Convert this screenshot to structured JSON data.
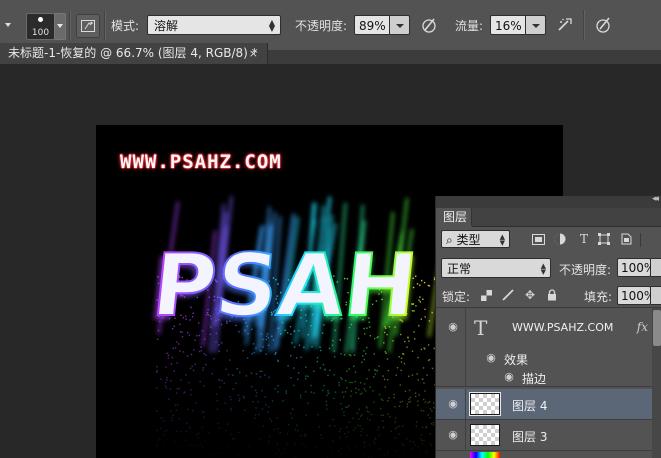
{
  "options_bar": {
    "brush_size": "100",
    "mode_label": "模式:",
    "mode_value": "溶解",
    "opacity_label": "不透明度:",
    "opacity_value": "89%",
    "flow_label": "流量:",
    "flow_value": "16%"
  },
  "document_tab": {
    "title": "未标题-1-恢复的 @ 66.7% (图层 4, RGB/8) *",
    "close": "×"
  },
  "canvas": {
    "watermark": "WWW.PSAHZ.COM",
    "art_text": "PSAH"
  },
  "layers_panel": {
    "tab_label": "图层",
    "filter_value": "类型",
    "blend_mode": "正常",
    "opacity_label": "不透明度:",
    "opacity_value": "100%",
    "lock_label": "锁定:",
    "fill_label": "填充:",
    "fill_value": "100%",
    "layers": [
      {
        "name": "WWW.PSAHZ.COM",
        "kind": "text",
        "fx": "fx"
      },
      {
        "name": "效果",
        "kind": "effects"
      },
      {
        "name": "描边",
        "kind": "effect"
      },
      {
        "name": "图层 4",
        "kind": "pixel",
        "selected": true
      },
      {
        "name": "图层 3",
        "kind": "pixel"
      }
    ]
  },
  "colors": {
    "accent_selected_row": "#5b6677",
    "watermark_outline": "#c0202a"
  }
}
